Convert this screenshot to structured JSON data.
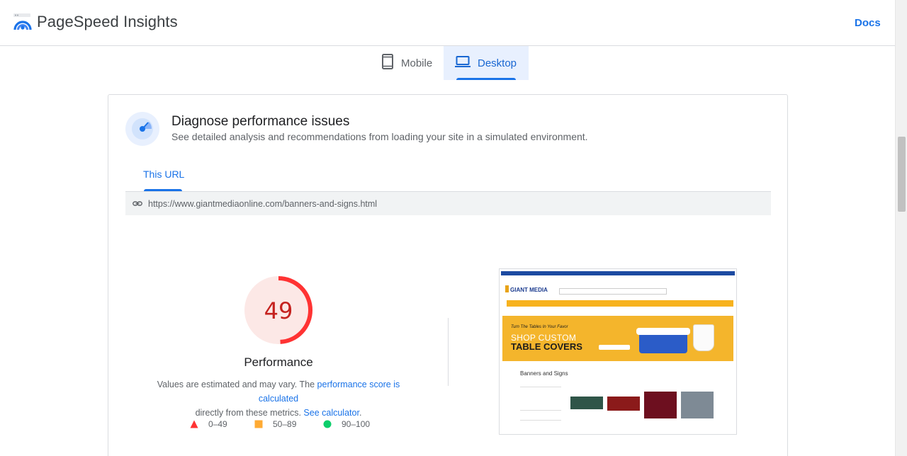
{
  "app": {
    "title": "PageSpeed Insights",
    "docs_label": "Docs"
  },
  "device_tabs": [
    {
      "label": "Mobile",
      "icon": "smartphone-icon",
      "selected": false
    },
    {
      "label": "Desktop",
      "icon": "laptop-icon",
      "selected": true
    }
  ],
  "diagnose": {
    "title": "Diagnose performance issues",
    "subtitle": "See detailed analysis and recommendations from loading your site in a simulated environment.",
    "icon": "gauge-icon"
  },
  "url_tab": {
    "label": "This URL"
  },
  "url_bar": {
    "icon": "link-icon",
    "url": "https://www.giantmediaonline.com/banners-and-signs.html"
  },
  "performance": {
    "score": "49",
    "score_fraction": 0.49,
    "label": "Performance",
    "note_part1": "Values are estimated and may vary. The ",
    "note_link1": "performance score is calculated",
    "note_part2": "directly from these metrics. ",
    "note_link2": "See calculator",
    "note_end": "."
  },
  "legend": [
    {
      "range": "0–49",
      "shape": "triangle",
      "color": "#ff3333"
    },
    {
      "range": "50–89",
      "shape": "square",
      "color": "#ffaa33"
    },
    {
      "range": "90–100",
      "shape": "circle",
      "color": "#0cce6b"
    }
  ],
  "colors": {
    "accent": "#1a73e8",
    "fail": "#ff3333",
    "fail_bg": "#fce8e6",
    "tab_selected_bg": "#e8f0fe"
  },
  "thumbnail": {
    "logo_text": "GIANT MEDIA",
    "banner_small": "Turn The Tables In Your Favor",
    "banner_line1": "SHOP CUSTOM",
    "banner_line2": "TABLE COVERS",
    "section_title": "Banners and Signs"
  }
}
